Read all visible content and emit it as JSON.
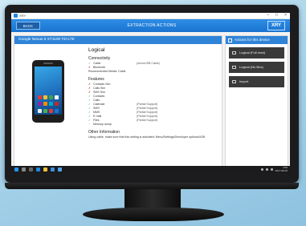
{
  "window": {
    "app_name": "XRY",
    "minimize_glyph": "–",
    "maximize_glyph": "□",
    "close_glyph": "×"
  },
  "header": {
    "back_label": "BACK",
    "title": "EXTRACTION ACTIONS",
    "logo": "XRY"
  },
  "device": {
    "name": "Google Nexus 6 XT1100 TD-LTE"
  },
  "info": {
    "heading": "Logical",
    "connectivity": {
      "title": "Connectivity",
      "rows": [
        {
          "mark": "✓",
          "status": "ok",
          "name": "Cable",
          "note": "(microUSB Cable)"
        },
        {
          "mark": "✗",
          "status": "bad",
          "name": "Bluetooth",
          "note": ""
        }
      ],
      "recommended": "Recommended Media: Cable"
    },
    "features": {
      "title": "Features",
      "rows": [
        {
          "mark": "✗",
          "status": "bad",
          "name": "Contacts Sim",
          "note": ""
        },
        {
          "mark": "✗",
          "status": "bad",
          "name": "Calls Sim",
          "note": ""
        },
        {
          "mark": "✗",
          "status": "bad",
          "name": "SMS Sim",
          "note": ""
        },
        {
          "mark": "✓",
          "status": "ok",
          "name": "Contacts",
          "note": ""
        },
        {
          "mark": "✓",
          "status": "ok",
          "name": "Calls",
          "note": ""
        },
        {
          "mark": "✓",
          "status": "ok",
          "name": "Calendar",
          "note": "(Partial Support)"
        },
        {
          "mark": "✓",
          "status": "ok",
          "name": "SMS",
          "note": "(Partial Support)"
        },
        {
          "mark": "✓",
          "status": "ok",
          "name": "MMS",
          "note": "(Partial Support)"
        },
        {
          "mark": "✓",
          "status": "ok",
          "name": "E-mail",
          "note": "(Partial Support)"
        },
        {
          "mark": "✓",
          "status": "ok",
          "name": "Files",
          "note": "(Partial Support)"
        },
        {
          "mark": "~",
          "status": "neutral",
          "name": "Memory dump",
          "note": ""
        }
      ]
    },
    "other": {
      "title": "Other Information",
      "text": "Using cable, make sure that this setting is activated: Menu/Settings/Developer options/USB"
    }
  },
  "actions": {
    "title": "Actions for this device",
    "buttons": [
      {
        "label": "Logical (Full read)"
      },
      {
        "label": "Logical (No files)"
      },
      {
        "label": "Import"
      }
    ]
  },
  "taskbar": {
    "time": "4:00",
    "date": "2017-08-15"
  },
  "colors": {
    "header_blue": "#1a73d0",
    "action_button": "#3a3a3a",
    "supported": "#2e9e3e",
    "unsupported": "#d23b3b"
  }
}
